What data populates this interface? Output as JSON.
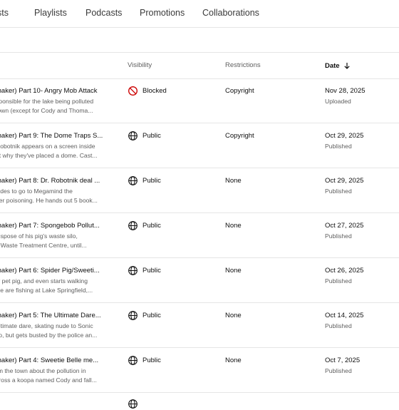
{
  "tabs": [
    {
      "label": "sts"
    },
    {
      "label": "Playlists"
    },
    {
      "label": "Podcasts"
    },
    {
      "label": "Promotions"
    },
    {
      "label": "Collaborations"
    }
  ],
  "columns": {
    "visibility": "Visibility",
    "restrictions": "Restrictions",
    "date": "Date",
    "date_sort_icon": "arrow-down-icon"
  },
  "rows": [
    {
      "title": "maker) Part 10- Angry Mob Attack",
      "desc_line1": "sponsible for the lake being polluted",
      "desc_line2": "town (except for Cody and Thoma...",
      "visibility": "Blocked",
      "visibility_icon": "blocked-icon",
      "restrictions": "Copyright",
      "date": "Nov 28, 2025",
      "status": "Uploaded"
    },
    {
      "title": "maker) Part 9: The Dome Traps S...",
      "desc_line1": "Robotnik appears on a screen inside",
      "desc_line2": "ut why they've placed a dome. Cast...",
      "visibility": "Public",
      "visibility_icon": "globe-icon",
      "restrictions": "Copyright",
      "date": "Oct 29, 2025",
      "status": "Published"
    },
    {
      "title": "maker) Part 8: Dr. Robotnik deal ...",
      "desc_line1": "cides to go to Megamind the",
      "desc_line2": "her poisoning. He hands out 5 book...",
      "visibility": "Public",
      "visibility_icon": "globe-icon",
      "restrictions": "None",
      "date": "Oct 29, 2025",
      "status": "Published"
    },
    {
      "title": "maker) Part 7: Spongebob Pollut...",
      "desc_line1": "dispose of his pig's waste silo,",
      "desc_line2": "s Waste Treatment Centre, until...",
      "visibility": "Public",
      "visibility_icon": "globe-icon",
      "restrictions": "None",
      "date": "Oct 27, 2025",
      "status": "Published"
    },
    {
      "title": "maker) Part 6: Spider Pig/Sweeti...",
      "desc_line1": "w pet pig, and even starts walking",
      "desc_line2": "ike are fishing at Lake Springfield,...",
      "visibility": "Public",
      "visibility_icon": "globe-icon",
      "restrictions": "None",
      "date": "Oct 26, 2025",
      "status": "Published"
    },
    {
      "title": "maker) Part 5: The Ultimate Dare...",
      "desc_line1": "ultimate dare, skating nude to Sonic",
      "desc_line2": "so, but gets busted by the police an...",
      "visibility": "Public",
      "visibility_icon": "globe-icon",
      "restrictions": "None",
      "date": "Oct 14, 2025",
      "status": "Published"
    },
    {
      "title": "maker) Part 4: Sweetie Belle me...",
      "desc_line1": "rm the town about the pollution in",
      "desc_line2": "cross a koopa named Cody and fall...",
      "visibility": "Public",
      "visibility_icon": "globe-icon",
      "restrictions": "None",
      "date": "Oct 7, 2025",
      "status": "Published"
    }
  ],
  "partial_row": {
    "visibility_icon": "globe-icon"
  },
  "colors": {
    "blocked": "#cc0000",
    "text": "#0f0f0f",
    "muted": "#606060",
    "divider": "#e5e5e5"
  }
}
